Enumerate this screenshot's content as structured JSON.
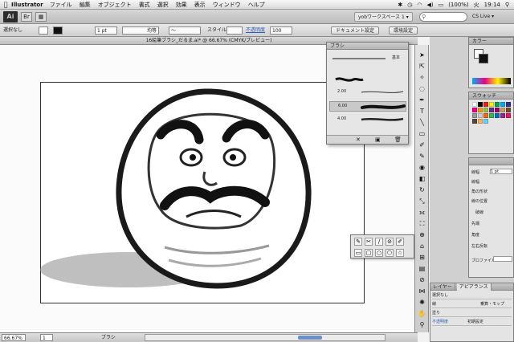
{
  "menubar": {
    "app_name": "Illustrator",
    "items": [
      "ファイル",
      "編集",
      "オブジェクト",
      "書式",
      "選択",
      "効果",
      "表示",
      "ウィンドウ",
      "ヘルプ"
    ],
    "battery": "(100%)",
    "day": "火",
    "time": "19:14"
  },
  "appbar": {
    "logo": "Ai",
    "workspace": "yobワークスペース 1 ▾",
    "search_placeholder": "",
    "cs_live": "CS Live ▾"
  },
  "controlbar": {
    "selection": "選択なし",
    "stroke_weight": "1 pt",
    "profile": "均等",
    "style_label": "スタイル",
    "opacity_label": "不透明度",
    "opacity_value": "100",
    "doc_settings_button": "ドキュメント設定",
    "prefs_button": "環境設定"
  },
  "document": {
    "title": "16絵筆ブラシ_だるま.ai* @ 66.67% (CMYK/プレビュー)"
  },
  "statusbar": {
    "zoom": "66.67%",
    "page": "1",
    "tool": "ブラシ"
  },
  "brush_panel": {
    "title": "ブラシ",
    "basic_label": "基本",
    "brushes": [
      {
        "size": "2.00"
      },
      {
        "size": "6.00"
      },
      {
        "size": "4.00"
      }
    ]
  },
  "color_panel": {
    "title": "カラー"
  },
  "swatch_panel": {
    "title": "スウォッチ"
  },
  "props_panel": {
    "labels": [
      "線幅",
      "線幅",
      "角の形状",
      "線の位置",
      "破線",
      "先端",
      "角度",
      "左右反転",
      "プロファイル"
    ],
    "value": "1 pt"
  },
  "appearance_panel": {
    "tabs": [
      "レイヤー",
      "アピアランス"
    ],
    "rows": [
      "選択なし",
      "線",
      "塗り",
      "不透明度"
    ],
    "blend_value": "乗算・モップ",
    "opacity_value": "初期設定"
  },
  "colors": {
    "accent_blue": "#6d8fc8",
    "ui_gray": "#d0d0d0"
  }
}
